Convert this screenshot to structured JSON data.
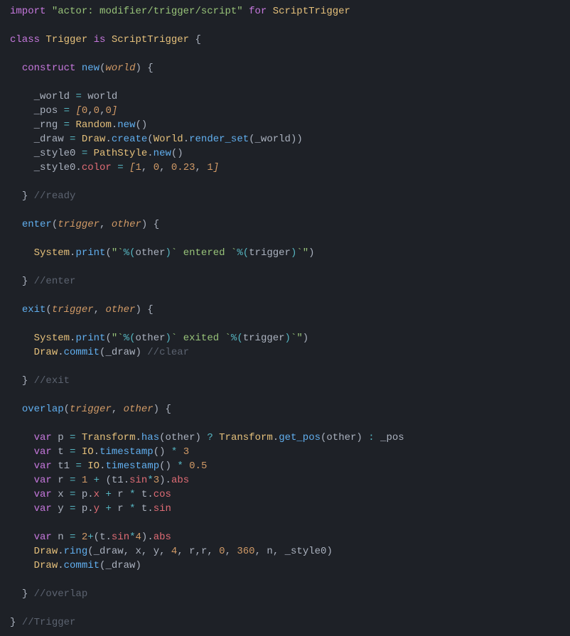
{
  "code": {
    "line1": {
      "kw1": "import",
      "str": "\"actor: modifier/trigger/script\"",
      "kw2": "for",
      "cls": "ScriptTrigger"
    },
    "line3": {
      "kw1": "class",
      "cls1": "Trigger",
      "kw2": "is",
      "cls2": "ScriptTrigger",
      "brace": "{"
    },
    "construct": {
      "kw": "construct",
      "fn": "new",
      "lp": "(",
      "param": "world",
      "rp": ")",
      "brace": "{"
    },
    "world_assign": {
      "lhs": "_world",
      "eq": "=",
      "rhs": "world"
    },
    "pos_assign": {
      "lhs": "_pos",
      "eq": "=",
      "lb": "[",
      "n0": "0",
      "c1": ",",
      "n1": "0",
      "c2": ",",
      "n2": "0",
      "rb": "]"
    },
    "rng_assign": {
      "lhs": "_rng",
      "eq": "=",
      "cls": "Random",
      "dot": ".",
      "fn": "new",
      "par": "()"
    },
    "draw_assign": {
      "lhs": "_draw",
      "eq": "=",
      "cls1": "Draw",
      "dot1": ".",
      "fn1": "create",
      "lp": "(",
      "cls2": "World",
      "dot2": ".",
      "fn2": "render_set",
      "lp2": "(",
      "arg": "_world",
      "rp2": ")",
      "rp": ")"
    },
    "style0_assign": {
      "lhs": "_style0",
      "eq": "=",
      "cls": "PathStyle",
      "dot": ".",
      "fn": "new",
      "par": "()"
    },
    "style0_color": {
      "obj": "_style0",
      "dot": ".",
      "prop": "color",
      "eq": "=",
      "lb": "[",
      "n0": "1",
      "c1": ", ",
      "n1": "0",
      "c2": ", ",
      "n2": "0.23",
      "c3": ", ",
      "n3": "1",
      "rb": "]"
    },
    "end_ready": {
      "brace": "}",
      "cmt": "//ready"
    },
    "enter_sig": {
      "fn": "enter",
      "lp": "(",
      "p1": "trigger",
      "comma": ", ",
      "p2": "other",
      "rp": ")",
      "brace": "{"
    },
    "enter_body": {
      "cls": "System",
      "dot": ".",
      "fn": "print",
      "lp": "(",
      "s1": "\"`",
      "pct1": "%(",
      "v1": "other",
      "rp1": ")",
      "s2": "` entered `",
      "pct2": "%(",
      "v2": "trigger",
      "rp2": ")",
      "s3": "`\"",
      "rp": ")"
    },
    "end_enter": {
      "brace": "}",
      "cmt": "//enter"
    },
    "exit_sig": {
      "fn": "exit",
      "lp": "(",
      "p1": "trigger",
      "comma": ", ",
      "p2": "other",
      "rp": ")",
      "brace": "{"
    },
    "exit_body1": {
      "cls": "System",
      "dot": ".",
      "fn": "print",
      "lp": "(",
      "s1": "\"`",
      "pct1": "%(",
      "v1": "other",
      "rp1": ")",
      "s2": "` exited `",
      "pct2": "%(",
      "v2": "trigger",
      "rp2": ")",
      "s3": "`\"",
      "rp": ")"
    },
    "exit_body2": {
      "cls": "Draw",
      "dot": ".",
      "fn": "commit",
      "lp": "(",
      "arg": "_draw",
      "rp": ")",
      "cmt": "//clear"
    },
    "end_exit": {
      "brace": "}",
      "cmt": "//exit"
    },
    "overlap_sig": {
      "fn": "overlap",
      "lp": "(",
      "p1": "trigger",
      "comma": ", ",
      "p2": "other",
      "rp": ")",
      "brace": "{"
    },
    "ov_p": {
      "kw": "var",
      "name": "p",
      "eq": "=",
      "cls1": "Transform",
      "dot1": ".",
      "fn1": "has",
      "lp1": "(",
      "arg1": "other",
      "rp1": ")",
      "q": "?",
      "cls2": "Transform",
      "dot2": ".",
      "fn2": "get_pos",
      "lp2": "(",
      "arg2": "other",
      "rp2": ")",
      "colon": ":",
      "alt": "_pos"
    },
    "ov_t": {
      "kw": "var",
      "name": "t",
      "eq": "=",
      "cls": "IO",
      "dot": ".",
      "fn": "timestamp",
      "par": "()",
      "mul": "*",
      "n": "3"
    },
    "ov_t1": {
      "kw": "var",
      "name": "t1",
      "eq": "=",
      "cls": "IO",
      "dot": ".",
      "fn": "timestamp",
      "par": "()",
      "mul": "*",
      "n": "0.5"
    },
    "ov_r": {
      "kw": "var",
      "name": "r",
      "eq": "=",
      "n1": "1",
      "plus": "+",
      "lp": "(",
      "obj": "t1",
      "dot": ".",
      "prop": "sin",
      "mul": "*",
      "n2": "3",
      "rp": ")",
      "dot2": ".",
      "prop2": "abs"
    },
    "ov_x": {
      "kw": "var",
      "name": "x",
      "eq": "=",
      "obj": "p",
      "dot": ".",
      "prop": "x",
      "plus": "+",
      "r": "r",
      "mul": "*",
      "obj2": "t",
      "dot2": ".",
      "prop2": "cos"
    },
    "ov_y": {
      "kw": "var",
      "name": "y",
      "eq": "=",
      "obj": "p",
      "dot": ".",
      "prop": "y",
      "plus": "+",
      "r": "r",
      "mul": "*",
      "obj2": "t",
      "dot2": ".",
      "prop2": "sin"
    },
    "ov_n": {
      "kw": "var",
      "name": "n",
      "eq": "=",
      "n1": "2",
      "plus": "+",
      "lp": "(",
      "obj": "t",
      "dot": ".",
      "prop": "sin",
      "mul": "*",
      "n2": "4",
      "rp": ")",
      "dot2": ".",
      "prop2": "abs"
    },
    "ov_ring": {
      "cls": "Draw",
      "dot": ".",
      "fn": "ring",
      "lp": "(",
      "a1": "_draw",
      "c1": ", ",
      "a2": "x",
      "c2": ", ",
      "a3": "y",
      "c3": ", ",
      "n4": "4",
      "c4": ", ",
      "a5": "r",
      "c5": ",",
      "a6": "r",
      "c6": ", ",
      "n0": "0",
      "c7": ", ",
      "n360": "360",
      "c8": ", ",
      "a9": "n",
      "c9": ", ",
      "a10": "_style0",
      "rp": ")"
    },
    "ov_commit": {
      "cls": "Draw",
      "dot": ".",
      "fn": "commit",
      "lp": "(",
      "arg": "_draw",
      "rp": ")"
    },
    "end_overlap": {
      "brace": "}",
      "cmt": "//overlap"
    },
    "end_class": {
      "brace": "}",
      "cmt": "//Trigger"
    }
  }
}
